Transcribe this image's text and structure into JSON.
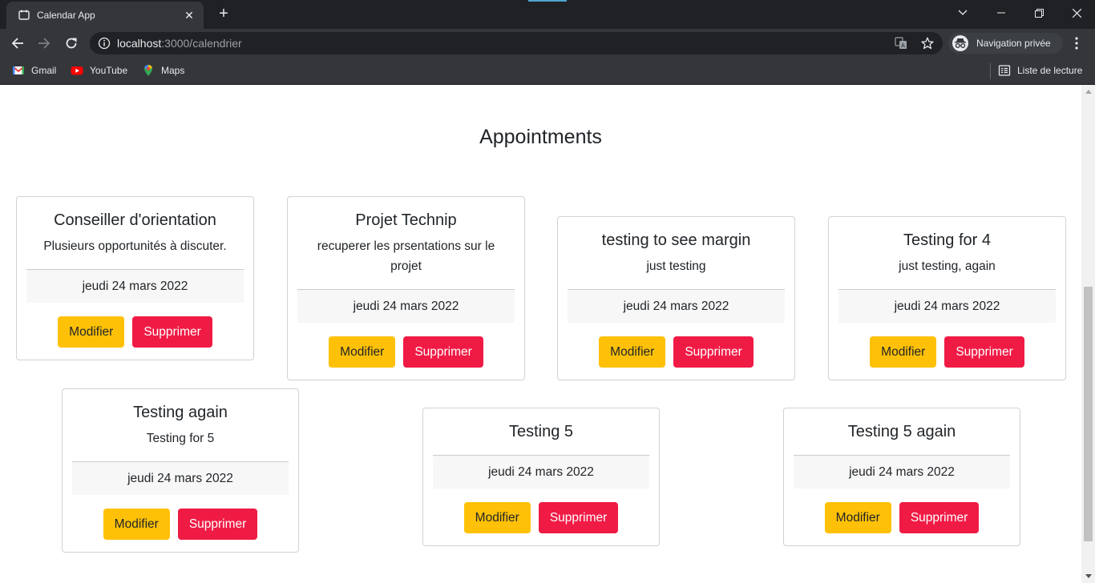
{
  "browser": {
    "tab_title": "Calendar App",
    "url_host": "localhost",
    "url_path": ":3000/calendrier",
    "profile_label": "Navigation privée",
    "bookmarks": [
      "Gmail",
      "YouTube",
      "Maps"
    ],
    "reading_list": "Liste de lecture"
  },
  "page": {
    "heading": "Appointments"
  },
  "appointments": [
    {
      "title": "Conseiller d'orientation",
      "description": "Plusieurs opportunités à discuter.",
      "date": "jeudi 24 mars 2022"
    },
    {
      "title": "Projet Technip",
      "description": "recuperer les prsentations sur le projet",
      "date": "jeudi 24 mars 2022"
    },
    {
      "title": "testing to see margin",
      "description": "just testing",
      "date": "jeudi 24 mars 2022"
    },
    {
      "title": "Testing for 4",
      "description": "just testing, again",
      "date": "jeudi 24 mars 2022"
    },
    {
      "title": "Testing again",
      "description": "Testing for 5",
      "date": "jeudi 24 mars 2022"
    },
    {
      "title": "Testing 5",
      "description": "",
      "date": "jeudi 24 mars 2022"
    },
    {
      "title": "Testing 5 again",
      "description": "",
      "date": "jeudi 24 mars 2022"
    }
  ],
  "buttons": {
    "edit": "Modifier",
    "delete": "Supprimer"
  },
  "colors": {
    "edit_button": "#ffc107",
    "delete_button": "#f01b45",
    "card_footer": "#f7f7f7",
    "chrome_dark": "#202124"
  }
}
